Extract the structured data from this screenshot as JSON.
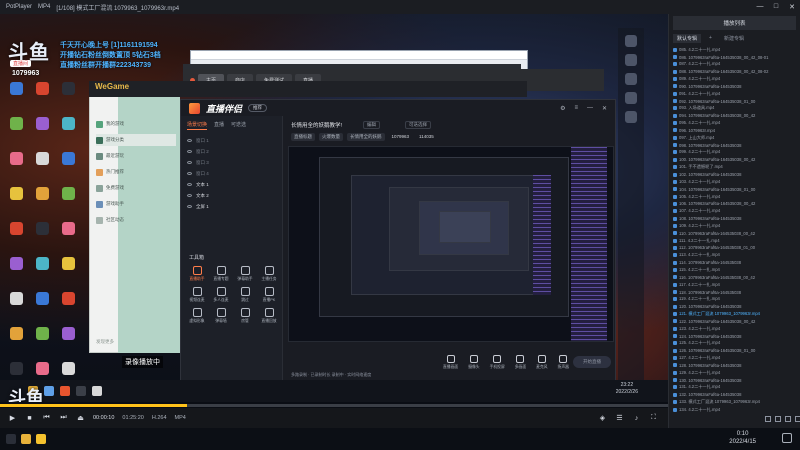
{
  "player": {
    "app_name": "PotPlayer",
    "menu": "MP4",
    "title": "[1/108] 模式工厂混流 1079963_1079963r.mp4",
    "window_buttons": [
      "—",
      "□",
      "✕"
    ]
  },
  "watermark": {
    "logo": "斗鱼",
    "sub": "直播间",
    "room": "1079963"
  },
  "ticker": [
    {
      "text": "千天开心晚上号 [1]1161191594",
      "color": "#4fb4ff"
    },
    {
      "text": "开播钻石粉丝倒数置顶 5钻石3档",
      "color": "#4fb4ff"
    },
    {
      "text": "直播粉丝群开播群222343739",
      "color": "#4fb4ff"
    }
  ],
  "browser": {
    "tabs": [
      {
        "label": "主页",
        "active": true
      },
      {
        "label": "商店",
        "active": false
      },
      {
        "label": "免费测试",
        "active": false
      },
      {
        "label": "直播",
        "active": false
      }
    ]
  },
  "wegame": {
    "brand": "WeGame",
    "items": [
      "我的游戏",
      "游戏分类",
      "最近游玩",
      "热门推荐",
      "免费游戏",
      "游戏助手",
      "社区动态"
    ],
    "footer": "发现更多"
  },
  "app": {
    "logo": "直播伴侣",
    "tag": "推荐",
    "scene_tabs": [
      "场景切换",
      "直播",
      "可迭选"
    ],
    "layers": [
      {
        "label": "窗口 1",
        "on": false
      },
      {
        "label": "窗口 2",
        "on": false
      },
      {
        "label": "窗口 3",
        "on": false
      },
      {
        "label": "窗口 4",
        "on": false
      },
      {
        "label": "文本 1",
        "on": true
      },
      {
        "label": "文本 2",
        "on": true
      },
      {
        "label": "全屏 1",
        "on": true
      }
    ],
    "toolbox_title": "工具箱",
    "tools": [
      {
        "label": "直播助手",
        "hot": true
      },
      {
        "label": "直播专题",
        "hot": false
      },
      {
        "label": "弹幕助手",
        "hot": false
      },
      {
        "label": "主播任务",
        "hot": false
      },
      {
        "label": "视频连麦",
        "hot": false
      },
      {
        "label": "多人连麦",
        "hot": false
      },
      {
        "label": "跳过",
        "hot": false
      },
      {
        "label": "直播PK",
        "hot": false
      },
      {
        "label": "虚拟形象",
        "hot": false
      },
      {
        "label": "弹幕墙",
        "hot": false
      },
      {
        "label": "房管",
        "hot": false
      },
      {
        "label": "直播回放",
        "hot": false
      }
    ],
    "stream_title": "长情用全的妖鹅教学!",
    "edit_label": "编辑",
    "area_label": "可迭选择",
    "meta": [
      "直播标题",
      "火爆数量",
      "长情用全的妖鹅",
      "1079963",
      "114035"
    ],
    "bottom_bar": [
      "直播画面",
      "摄像头",
      "手机投屏",
      "多画面",
      "麦克风",
      "扬声器"
    ],
    "start_live": "开始直播",
    "status": "多路录制 · 已录制时长 录制中 · 实时网络速度",
    "rec_tip": "录像播放中"
  },
  "inner_clock": {
    "time": "23:22",
    "date": "2022/2/26"
  },
  "controls": {
    "time_now": "00:00:10",
    "time_total": "01:25:20",
    "format": "H.264",
    "container": "MP4",
    "progress": 0.28,
    "accent": "#ffc21a"
  },
  "host_clock": {
    "time": "0:10",
    "date": "2022/4/15"
  },
  "playlist": {
    "title": "播放列表",
    "tabs": [
      "默认专辑",
      "+",
      "新建专辑"
    ],
    "items": [
      "085. 4.2二十一扎.mp4",
      "086. 1079963raFaf6a-164535038_00_42_08-01",
      "087. 4.2二十一扎.mp4",
      "088. 1079963raFaf6a-164535038_00_42_08-02",
      "089. 4.2二十一扎.mp4",
      "090. 1079963raFaf6a-164535038",
      "091. 4.2二十一扎.mp4",
      "092. 1079963raFaf6a-164535038_01_00",
      "093. 入场道具.mp4",
      "094. 1079963raFaf6a-164535038_00_42",
      "095. 4.2二十一扎.mp4",
      "096. 1079963r.mp4",
      "097. 上山大师.mp4",
      "098. 1079963raFaf6a-164535038",
      "099. 4.2二十一扎.mp4",
      "100. 1079963raFaf6a-164535038_00_42",
      "101. 手不遗憾呢了.mp4",
      "102. 1079963raFaf6a-164535038",
      "103. 4.2二十一扎.mp4",
      "104. 1079963raFaf6a-164535038_01_00",
      "105. 4.2二十一扎.mp4",
      "106. 1079963raFaf6a-164535038_00_42",
      "107. 4.2二十一扎.mp4",
      "108. 1079963raFaf6a-164535038",
      "109. 4.2二十一扎.mp4",
      "110. 1079963raFaf6a-164535038_00_42",
      "111. 4.2二十一扎.mp4",
      "112. 1079963raFaf6a-164535038_01_00",
      "113. 4.2二十一扎.mp4",
      "114. 1079963raFaf6a-164535038",
      "115. 4.2二十一扎.mp4",
      "116. 1079963raFaf6a-164535038_00_42",
      "117. 4.2二十一扎.mp4",
      "118. 1079963raFaf6a-164535038",
      "119. 4.2二十一扎.mp4",
      "120. 1079963raFaf6a-164535038",
      "121. 模式工厂混流 1079963_1079963r.mp4",
      "122. 1079963raFaf6a-164535038_00_42",
      "123. 4.2二十一扎.mp4",
      "124. 1079963raFaf6a-164535038",
      "125. 4.2二十一扎.mp4",
      "126. 1079963raFaf6a-164535038_01_00",
      "127. 4.2二十一扎.mp4",
      "128. 1079963raFaf6a-164535038",
      "129. 4.2二十一扎.mp4",
      "130. 1079963raFaf6a-164535038",
      "131. 4.2二十一扎.mp4",
      "132. 1079963raFaf6a-164535038",
      "133. 模式工厂混流 1079963_1079963r.mp4",
      "134. 4.2二十一扎.mp4"
    ],
    "current_index": 36
  }
}
